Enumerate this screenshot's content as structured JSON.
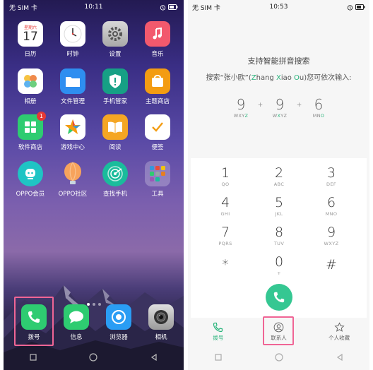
{
  "left_screen": {
    "status": {
      "carrier": "无 SIM 卡",
      "time": "10:11"
    },
    "calendar": {
      "weekday": "星期六",
      "day": "17"
    },
    "apps": [
      {
        "label": "日历",
        "icon": "calendar-icon"
      },
      {
        "label": "时钟",
        "icon": "clock-icon"
      },
      {
        "label": "设置",
        "icon": "gear-icon"
      },
      {
        "label": "音乐",
        "icon": "music-note-icon"
      },
      {
        "label": "相册",
        "icon": "photo-album-icon"
      },
      {
        "label": "文件管理",
        "icon": "folder-icon"
      },
      {
        "label": "手机管家",
        "icon": "shield-icon"
      },
      {
        "label": "主题商店",
        "icon": "theme-store-icon"
      },
      {
        "label": "软件商店",
        "icon": "app-store-icon",
        "badge": "1"
      },
      {
        "label": "游戏中心",
        "icon": "game-center-icon"
      },
      {
        "label": "阅读",
        "icon": "book-icon"
      },
      {
        "label": "便签",
        "icon": "notes-icon"
      },
      {
        "label": "OPPO会员",
        "icon": "member-icon"
      },
      {
        "label": "OPPO社区",
        "icon": "community-icon"
      },
      {
        "label": "查找手机",
        "icon": "find-phone-icon"
      },
      {
        "label": "工具",
        "icon": "tools-folder-icon"
      }
    ],
    "dock": [
      {
        "label": "拨号",
        "icon": "phone-icon"
      },
      {
        "label": "信息",
        "icon": "message-icon"
      },
      {
        "label": "浏览器",
        "icon": "browser-icon"
      },
      {
        "label": "相机",
        "icon": "camera-icon"
      }
    ]
  },
  "right_screen": {
    "status": {
      "carrier": "无 SIM 卡",
      "time": "10:53"
    },
    "pinyin_title": "支持智能拼音搜索",
    "pinyin_sub": {
      "prefix": "搜索“张小欧”(",
      "z": "Z",
      "hang": "hang ",
      "x": "X",
      "iao": "iao ",
      "o": "O",
      "u": "u",
      "suffix": ")您可依次输入:"
    },
    "example_keys": [
      {
        "digit": "9",
        "letters_a": "WXY",
        "letters_hl": "Z",
        "letters_b": ""
      },
      {
        "digit": "9",
        "letters_a": "W",
        "letters_hl": "X",
        "letters_b": "YZ"
      },
      {
        "digit": "6",
        "letters_a": "MN",
        "letters_hl": "O",
        "letters_b": ""
      }
    ],
    "example_plus": "+",
    "keypad": [
      {
        "n": "1",
        "t": "QO"
      },
      {
        "n": "2",
        "t": "ABC"
      },
      {
        "n": "3",
        "t": "DEF"
      },
      {
        "n": "4",
        "t": "GHI"
      },
      {
        "n": "5",
        "t": "JKL"
      },
      {
        "n": "6",
        "t": "MNO"
      },
      {
        "n": "7",
        "t": "PQRS"
      },
      {
        "n": "8",
        "t": "TUV"
      },
      {
        "n": "9",
        "t": "WXYZ"
      },
      {
        "n": "*",
        "t": ""
      },
      {
        "n": "0",
        "t": "+"
      },
      {
        "n": "#",
        "t": ""
      }
    ],
    "tabs": [
      {
        "label": "拨号",
        "icon": "dialpad-phone-icon"
      },
      {
        "label": "联系人",
        "icon": "contacts-icon"
      },
      {
        "label": "个人收藏",
        "icon": "star-icon"
      }
    ],
    "colors": {
      "accent": "#35c792",
      "highlight": "#f06595"
    }
  }
}
